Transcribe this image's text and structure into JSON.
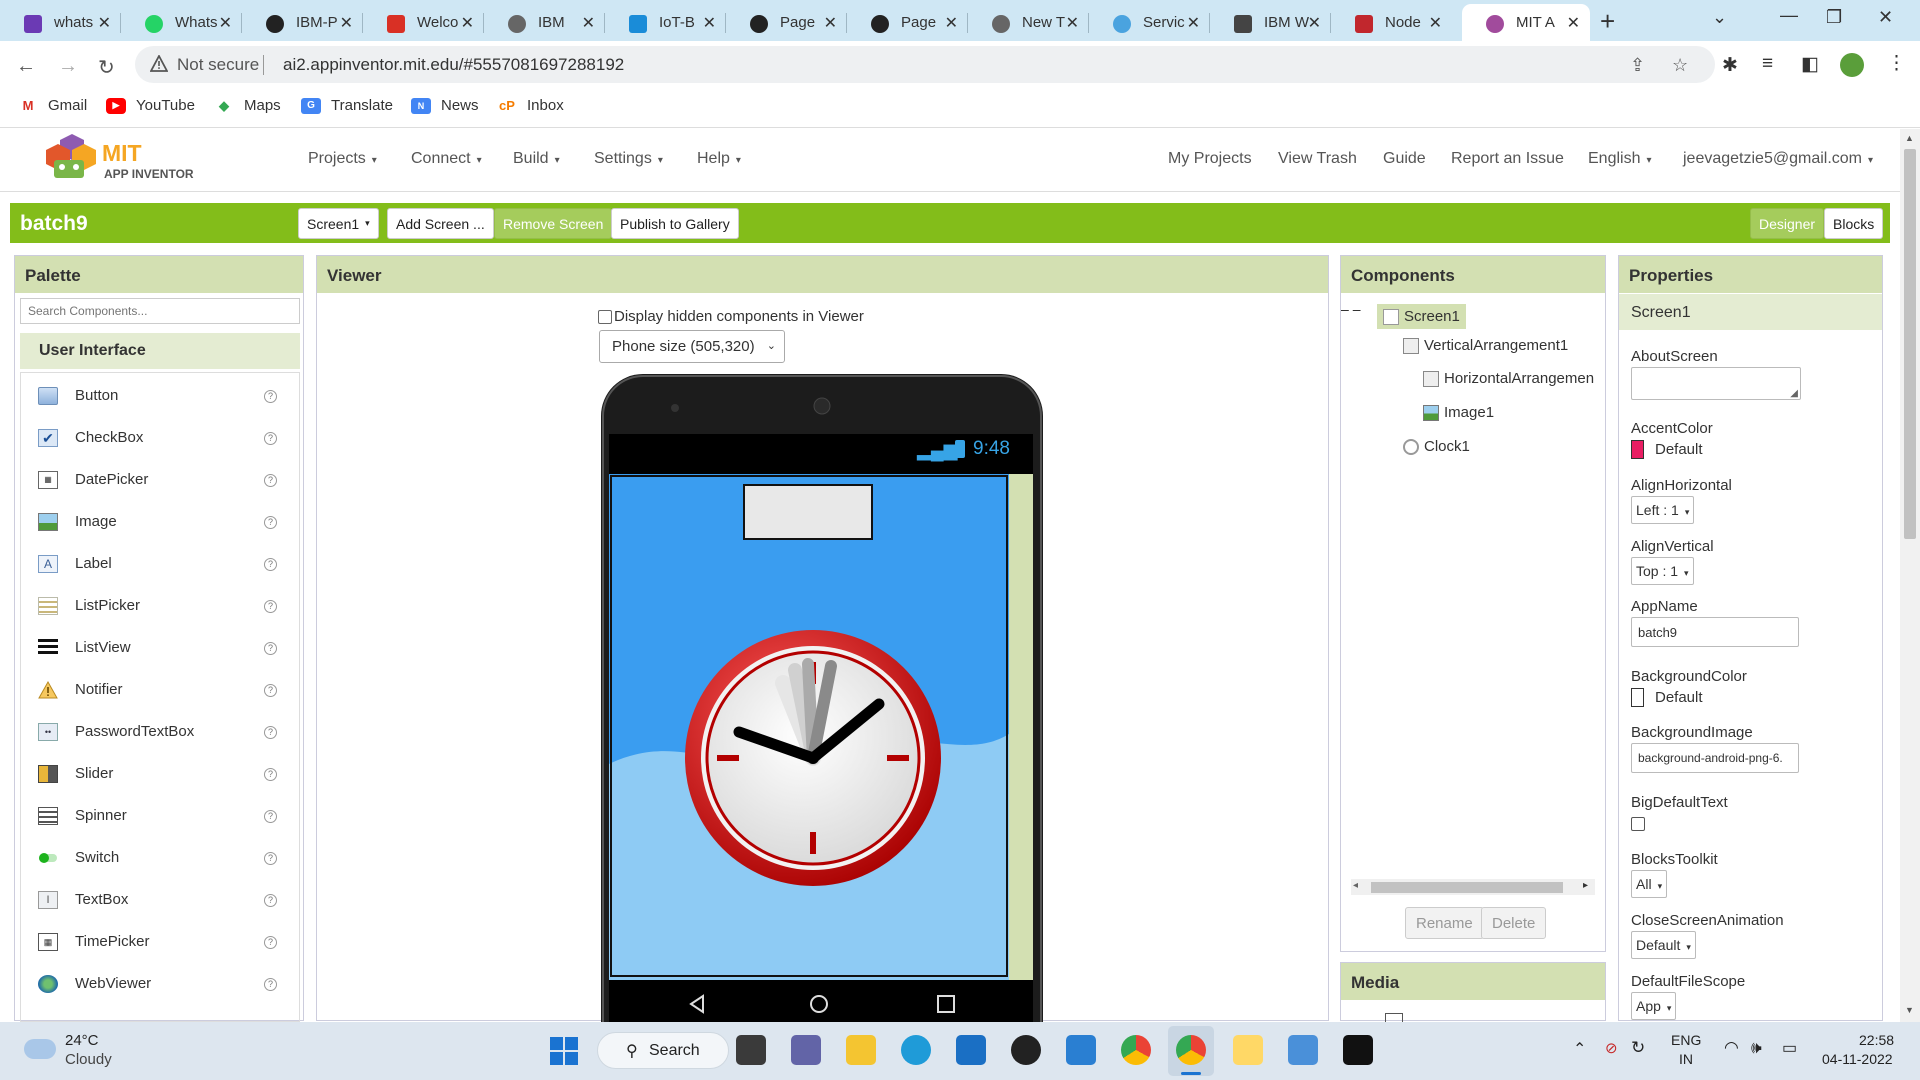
{
  "browser": {
    "tabs": [
      {
        "title": "whats",
        "color": "#6b3ab4"
      },
      {
        "title": "Whats",
        "color": "#25d366"
      },
      {
        "title": "IBM-P",
        "color": "#222222"
      },
      {
        "title": "Welco",
        "color": "#d93025"
      },
      {
        "title": "IBM",
        "color": "#666666"
      },
      {
        "title": "IoT-B",
        "color": "#1a8cd8"
      },
      {
        "title": "Page",
        "color": "#222222"
      },
      {
        "title": "Page",
        "color": "#222222"
      },
      {
        "title": "New T",
        "color": "#666666"
      },
      {
        "title": "Servic",
        "color": "#4aa3df"
      },
      {
        "title": "IBM W",
        "color": "#444444"
      },
      {
        "title": "Node",
        "color": "#c1272d"
      },
      {
        "title": "MIT A",
        "color": "#a14b9c"
      }
    ],
    "address": {
      "security": "Not secure",
      "url": "ai2.appinventor.mit.edu/#5557081697288192"
    },
    "bookmarks": [
      {
        "label": "Gmail",
        "icon": "gmail-icon"
      },
      {
        "label": "YouTube",
        "icon": "youtube-icon"
      },
      {
        "label": "Maps",
        "icon": "maps-icon"
      },
      {
        "label": "Translate",
        "icon": "translate-icon"
      },
      {
        "label": "News",
        "icon": "news-icon"
      },
      {
        "label": "Inbox",
        "icon": "inbox-icon"
      }
    ]
  },
  "app": {
    "logo_text": "MIT",
    "logo_sub": "APP INVENTOR",
    "menus": [
      "Projects",
      "Connect",
      "Build",
      "Settings",
      "Help"
    ],
    "right_links": [
      "My Projects",
      "View Trash",
      "Guide",
      "Report an Issue"
    ],
    "language": "English",
    "account": "jeevagetzie5@gmail.com",
    "project_name": "batch9",
    "screen_select": "Screen1",
    "add_screen": "Add Screen ...",
    "remove_screen": "Remove Screen",
    "publish": "Publish to Gallery",
    "designer": "Designer",
    "blocks": "Blocks",
    "accent": "#83bd1a"
  },
  "palette": {
    "title": "Palette",
    "search_placeholder": "Search Components...",
    "category": "User Interface",
    "items": [
      "Button",
      "CheckBox",
      "DatePicker",
      "Image",
      "Label",
      "ListPicker",
      "ListView",
      "Notifier",
      "PasswordTextBox",
      "Slider",
      "Spinner",
      "Switch",
      "TextBox",
      "TimePicker",
      "WebViewer"
    ]
  },
  "viewer": {
    "title": "Viewer",
    "hidden_label": "Display hidden components in Viewer",
    "phone_size": "Phone size (505,320)",
    "status_time": "9:48"
  },
  "components": {
    "title": "Components",
    "tree": [
      "Screen1",
      "VerticalArrangement1",
      "HorizontalArrangemen",
      "Image1",
      "Clock1"
    ],
    "rename": "Rename",
    "delete": "Delete",
    "media_title": "Media"
  },
  "properties": {
    "title": "Properties",
    "selected": "Screen1",
    "about_label": "AboutScreen",
    "accent_label": "AccentColor",
    "accent_value": "Default",
    "accent_color": "#e91e63",
    "alignh_label": "AlignHorizontal",
    "alignh_value": "Left : 1",
    "alignv_label": "AlignVertical",
    "alignv_value": "Top : 1",
    "appname_label": "AppName",
    "appname_value": "batch9",
    "bgcolor_label": "BackgroundColor",
    "bgcolor_value": "Default",
    "bgimage_label": "BackgroundImage",
    "bgimage_value": "background-android-png-6.",
    "bigtext_label": "BigDefaultText",
    "toolkit_label": "BlocksToolkit",
    "toolkit_value": "All",
    "anim_label": "CloseScreenAnimation",
    "anim_value": "Default",
    "scope_label": "DefaultFileScope",
    "scope_value": "App"
  },
  "taskbar": {
    "temp": "24°C",
    "weather": "Cloudy",
    "search": "Search",
    "lang1": "ENG",
    "lang2": "IN",
    "time": "22:58",
    "date": "04-11-2022"
  }
}
